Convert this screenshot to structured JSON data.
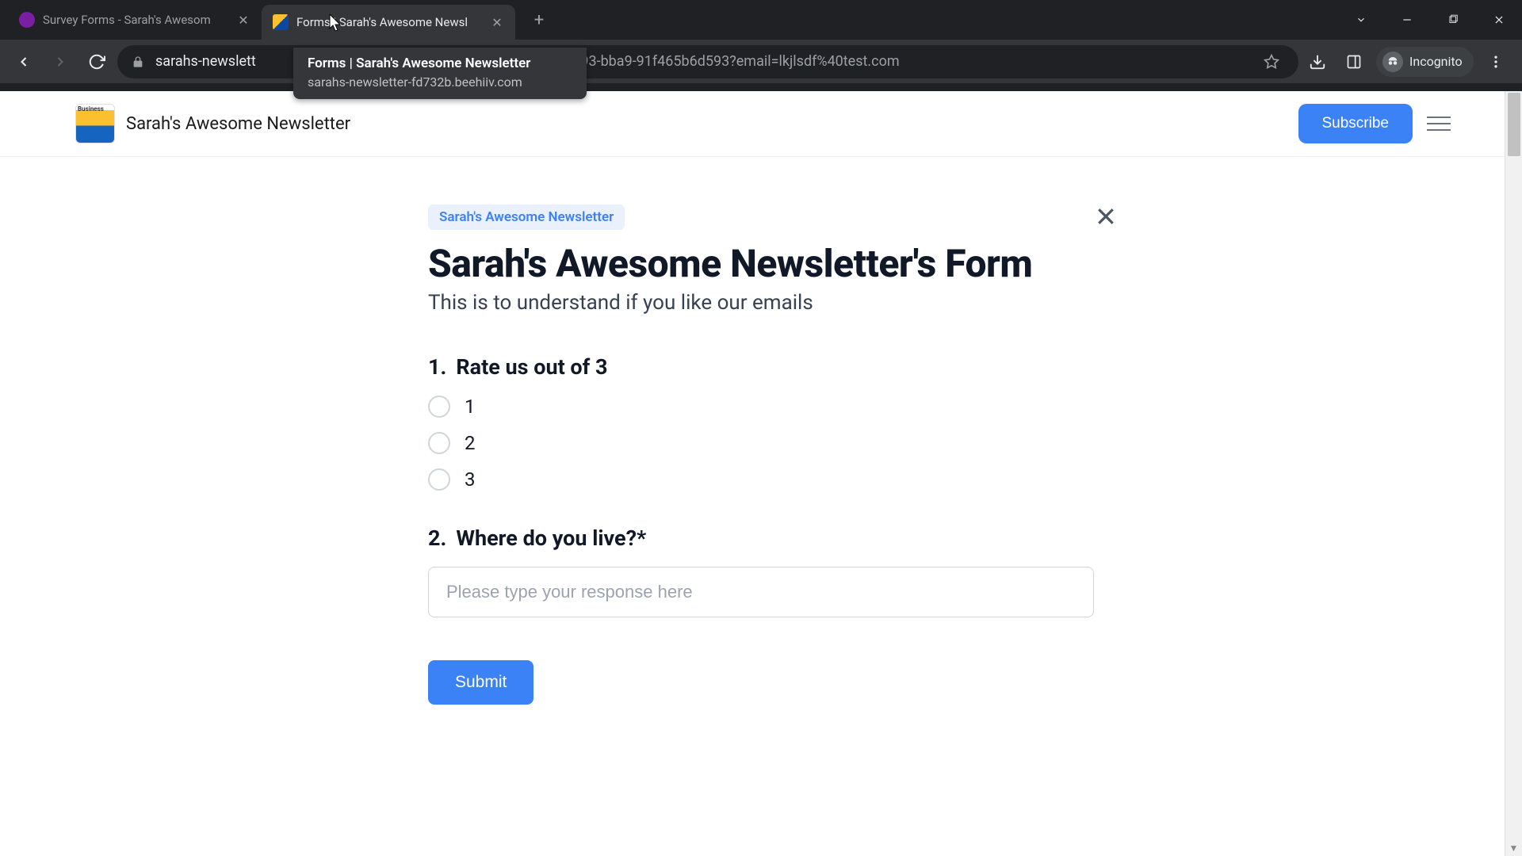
{
  "browser": {
    "tabs": [
      {
        "title": "Survey Forms - Sarah's Awesom",
        "active": false
      },
      {
        "title": "Forms | Sarah's Awesome Newsl",
        "active": true
      }
    ],
    "tooltip": {
      "title": "Forms | Sarah's Awesome Newsletter",
      "url": "sarahs-newsletter-fd732b.beehiiv.com"
    },
    "url_visible_left": "sarahs-newslett",
    "url_visible_right": "583-4793-bba9-91f465b6d593?email=lkjlsdf%40test.com",
    "incognito_label": "Incognito"
  },
  "site": {
    "brand_name": "Sarah's Awesome Newsletter",
    "subscribe_label": "Subscribe"
  },
  "form": {
    "tag": "Sarah's Awesome Newsletter",
    "title": "Sarah's Awesome Newsletter's Form",
    "subtitle": "This is to understand if you like our emails",
    "questions": [
      {
        "number": "1.",
        "label": "Rate us out of 3",
        "type": "radio",
        "options": [
          "1",
          "2",
          "3"
        ]
      },
      {
        "number": "2.",
        "label": "Where do you live?*",
        "type": "text",
        "placeholder": "Please type your response here"
      }
    ],
    "submit_label": "Submit"
  }
}
